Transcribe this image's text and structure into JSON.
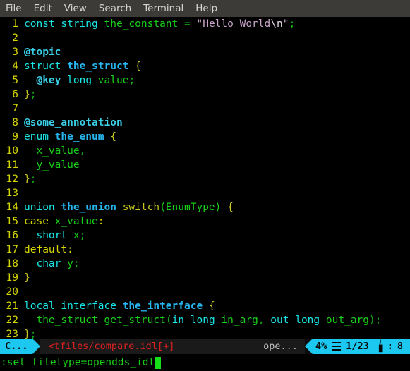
{
  "menubar": {
    "items": [
      {
        "label": "File"
      },
      {
        "label": "Edit"
      },
      {
        "label": "View"
      },
      {
        "label": "Search"
      },
      {
        "label": "Terminal"
      },
      {
        "label": "Help"
      }
    ]
  },
  "editor": {
    "filetype": "opendds_idl",
    "lines": [
      {
        "n": "1",
        "tokens": [
          {
            "t": "const",
            "c": "t-kw"
          },
          {
            "t": " ",
            "c": "t-plain"
          },
          {
            "t": "string",
            "c": "t-kw"
          },
          {
            "t": " ",
            "c": "t-plain"
          },
          {
            "t": "the_constant",
            "c": "t-ident"
          },
          {
            "t": " = ",
            "c": "t-punc"
          },
          {
            "t": "\"Hello World",
            "c": "t-str"
          },
          {
            "t": "\\n",
            "c": "t-esc"
          },
          {
            "t": "\"",
            "c": "t-str"
          },
          {
            "t": ";",
            "c": "t-punc"
          }
        ]
      },
      {
        "n": "2",
        "tokens": []
      },
      {
        "n": "3",
        "tokens": [
          {
            "t": "@topic",
            "c": "t-annot"
          }
        ]
      },
      {
        "n": "4",
        "tokens": [
          {
            "t": "struct",
            "c": "t-kw"
          },
          {
            "t": " ",
            "c": "t-plain"
          },
          {
            "t": "the_struct",
            "c": "t-name"
          },
          {
            "t": " ",
            "c": "t-plain"
          },
          {
            "t": "{",
            "c": "t-brace"
          }
        ]
      },
      {
        "n": "5",
        "tokens": [
          {
            "t": "  ",
            "c": "t-plain"
          },
          {
            "t": "@key",
            "c": "t-annot"
          },
          {
            "t": " ",
            "c": "t-plain"
          },
          {
            "t": "long",
            "c": "t-kw"
          },
          {
            "t": " ",
            "c": "t-plain"
          },
          {
            "t": "value",
            "c": "t-ident"
          },
          {
            "t": ";",
            "c": "t-punc"
          }
        ]
      },
      {
        "n": "6",
        "tokens": [
          {
            "t": "}",
            "c": "t-brace"
          },
          {
            "t": ";",
            "c": "t-punc"
          }
        ]
      },
      {
        "n": "7",
        "tokens": []
      },
      {
        "n": "8",
        "tokens": [
          {
            "t": "@some_annotation",
            "c": "t-annot"
          }
        ]
      },
      {
        "n": "9",
        "tokens": [
          {
            "t": "enum",
            "c": "t-kw"
          },
          {
            "t": " ",
            "c": "t-plain"
          },
          {
            "t": "the_enum",
            "c": "t-name"
          },
          {
            "t": " ",
            "c": "t-plain"
          },
          {
            "t": "{",
            "c": "t-brace"
          }
        ]
      },
      {
        "n": "10",
        "tokens": [
          {
            "t": "  ",
            "c": "t-plain"
          },
          {
            "t": "x_value",
            "c": "t-ident"
          },
          {
            "t": ",",
            "c": "t-punc"
          }
        ]
      },
      {
        "n": "11",
        "tokens": [
          {
            "t": "  ",
            "c": "t-plain"
          },
          {
            "t": "y_value",
            "c": "t-ident"
          }
        ]
      },
      {
        "n": "12",
        "tokens": [
          {
            "t": "}",
            "c": "t-brace"
          },
          {
            "t": ";",
            "c": "t-punc"
          }
        ]
      },
      {
        "n": "13",
        "tokens": []
      },
      {
        "n": "14",
        "tokens": [
          {
            "t": "union",
            "c": "t-kw"
          },
          {
            "t": " ",
            "c": "t-plain"
          },
          {
            "t": "the_union",
            "c": "t-name"
          },
          {
            "t": " ",
            "c": "t-plain"
          },
          {
            "t": "switch",
            "c": "t-brace"
          },
          {
            "t": "(",
            "c": "t-ident"
          },
          {
            "t": "EnumType",
            "c": "t-ident"
          },
          {
            "t": ")",
            "c": "t-ident"
          },
          {
            "t": " ",
            "c": "t-plain"
          },
          {
            "t": "{",
            "c": "t-brace"
          }
        ]
      },
      {
        "n": "15",
        "tokens": [
          {
            "t": "case",
            "c": "t-label"
          },
          {
            "t": " ",
            "c": "t-plain"
          },
          {
            "t": "x_value",
            "c": "t-ident"
          },
          {
            "t": ":",
            "c": "t-label"
          }
        ]
      },
      {
        "n": "16",
        "tokens": [
          {
            "t": "  ",
            "c": "t-plain"
          },
          {
            "t": "short",
            "c": "t-kw"
          },
          {
            "t": " ",
            "c": "t-plain"
          },
          {
            "t": "x",
            "c": "t-ident"
          },
          {
            "t": ";",
            "c": "t-punc"
          }
        ]
      },
      {
        "n": "17",
        "tokens": [
          {
            "t": "default",
            "c": "t-label"
          },
          {
            "t": ":",
            "c": "t-label"
          }
        ]
      },
      {
        "n": "18",
        "tokens": [
          {
            "t": "  ",
            "c": "t-plain"
          },
          {
            "t": "char",
            "c": "t-kw"
          },
          {
            "t": " ",
            "c": "t-plain"
          },
          {
            "t": "y",
            "c": "t-ident"
          },
          {
            "t": ";",
            "c": "t-punc"
          }
        ]
      },
      {
        "n": "19",
        "tokens": [
          {
            "t": "}",
            "c": "t-brace"
          }
        ]
      },
      {
        "n": "20",
        "tokens": []
      },
      {
        "n": "21",
        "tokens": [
          {
            "t": "local",
            "c": "t-kw"
          },
          {
            "t": " ",
            "c": "t-plain"
          },
          {
            "t": "interface",
            "c": "t-kw"
          },
          {
            "t": " ",
            "c": "t-plain"
          },
          {
            "t": "the_interface",
            "c": "t-name"
          },
          {
            "t": " ",
            "c": "t-plain"
          },
          {
            "t": "{",
            "c": "t-brace"
          }
        ]
      },
      {
        "n": "22",
        "tokens": [
          {
            "t": "  ",
            "c": "t-plain"
          },
          {
            "t": "the_struct",
            "c": "t-ident"
          },
          {
            "t": " ",
            "c": "t-plain"
          },
          {
            "t": "get_struct",
            "c": "t-ident"
          },
          {
            "t": "(",
            "c": "t-punc"
          },
          {
            "t": "in",
            "c": "t-kw"
          },
          {
            "t": " ",
            "c": "t-plain"
          },
          {
            "t": "long",
            "c": "t-kw"
          },
          {
            "t": " ",
            "c": "t-plain"
          },
          {
            "t": "in_arg",
            "c": "t-ident"
          },
          {
            "t": ", ",
            "c": "t-punc"
          },
          {
            "t": "out",
            "c": "t-kw"
          },
          {
            "t": " ",
            "c": "t-plain"
          },
          {
            "t": "long",
            "c": "t-kw"
          },
          {
            "t": " ",
            "c": "t-plain"
          },
          {
            "t": "out_arg",
            "c": "t-ident"
          },
          {
            "t": ")",
            "c": "t-punc"
          },
          {
            "t": ";",
            "c": "t-punc"
          }
        ]
      },
      {
        "n": "23",
        "tokens": [
          {
            "t": "}",
            "c": "t-brace"
          },
          {
            "t": ";",
            "c": "t-punc"
          }
        ]
      }
    ],
    "plain_text": [
      "const string the_constant = \"Hello World\\n\";",
      "",
      "@topic",
      "struct the_struct {",
      "  @key long value;",
      "};",
      "",
      "@some_annotation",
      "enum the_enum {",
      "  x_value,",
      "  y_value",
      "};",
      "",
      "union the_union switch(EnumType) {",
      "case x_value:",
      "  short x;",
      "default:",
      "  char y;",
      "}",
      "",
      "local interface the_interface {",
      "  the_struct get_struct(in long in_arg, out long out_arg);",
      "};"
    ]
  },
  "statusline": {
    "mode": "C...",
    "filename": "<tfiles/compare.idl[+]",
    "filetype_short": "ope...",
    "percent": "4%",
    "lines_icon": "lines-icon",
    "position": "1/23",
    "column_icon": "column-icon",
    "column_separator": ":",
    "column": "8"
  },
  "cmdline": {
    "text": ":set filetype=opendds_idl",
    "cursor": "block-cursor"
  },
  "colors": {
    "background": "#000000",
    "menubar_bg": "#3c3b37",
    "menubar_fg": "#d6d6d0",
    "linenumber": "#d7d700",
    "accent": "#1cc8f0",
    "filename_fg": "#e02020",
    "keyword": "#19e6e6",
    "identifier": "#18d018",
    "typename": "#27b6ef",
    "annotation": "#3ad0e8",
    "string": "#c8a2c8",
    "brace": "#c8c820"
  }
}
